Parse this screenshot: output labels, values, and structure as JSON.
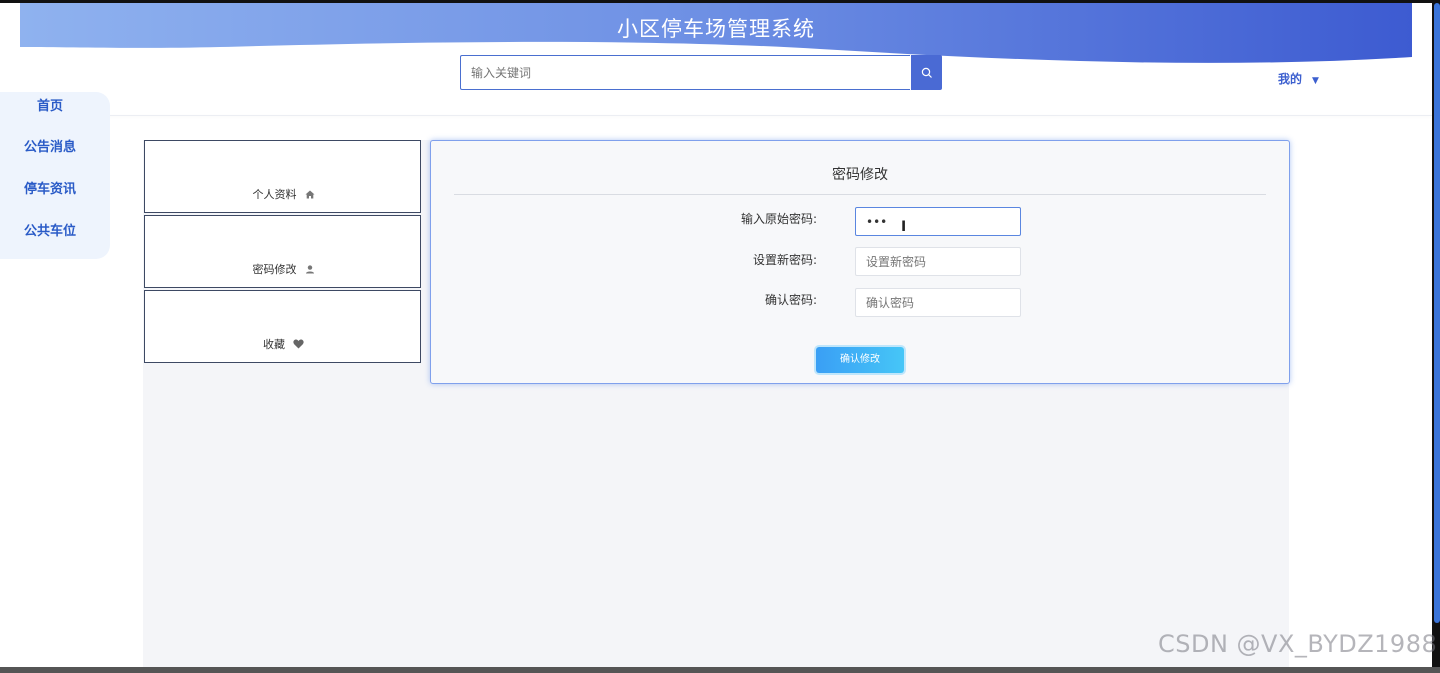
{
  "site": {
    "title": "小区停车场管理系统"
  },
  "search": {
    "placeholder": "输入关键词"
  },
  "user_menu": {
    "label": "我的"
  },
  "side_nav": {
    "items": [
      {
        "label": "首页"
      },
      {
        "label": "公告消息"
      },
      {
        "label": "停车资讯"
      },
      {
        "label": "公共车位"
      }
    ]
  },
  "center_tabs": [
    {
      "label": "个人资料",
      "icon": "home-icon"
    },
    {
      "label": "密码修改",
      "icon": "user-icon"
    },
    {
      "label": "收藏",
      "icon": "heart-icon"
    }
  ],
  "password_form": {
    "title": "密码修改",
    "old_password": {
      "label": "输入原始密码:",
      "value": "•••"
    },
    "new_password": {
      "label": "设置新密码:",
      "placeholder": "设置新密码"
    },
    "confirm_password": {
      "label": "确认密码:",
      "placeholder": "确认密码"
    },
    "submit_label": "确认修改"
  },
  "watermark": "CSDN @VX_BYDZ1988",
  "colors": {
    "primary": "#4a6ad4",
    "header_gradient_start": "#7ea6ec",
    "header_gradient_end": "#3f5fd2",
    "button_gradient": "#3a9ff5"
  }
}
